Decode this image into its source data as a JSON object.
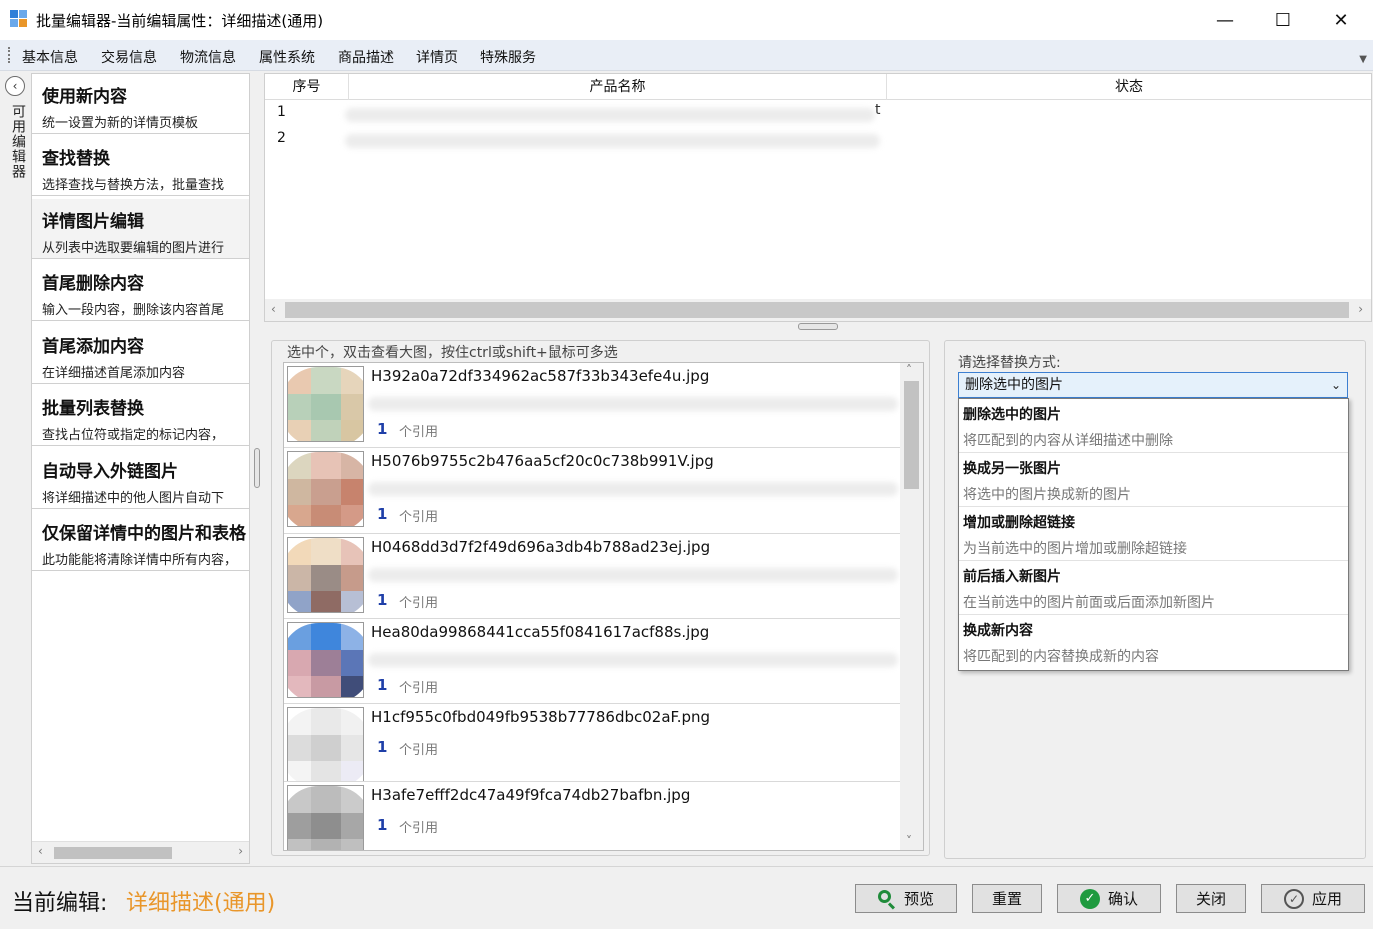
{
  "window": {
    "title": "批量编辑器-当前编辑属性：详细描述(通用)",
    "minimize": "—",
    "maximize": "☐",
    "close": "✕"
  },
  "tabs": [
    {
      "label": "基本信息"
    },
    {
      "label": "交易信息"
    },
    {
      "label": "物流信息"
    },
    {
      "label": "属性系统"
    },
    {
      "label": "商品描述"
    },
    {
      "label": "详情页"
    },
    {
      "label": "特殊服务"
    }
  ],
  "sidebar": {
    "collapse_icon": "‹",
    "label": "可用编辑器"
  },
  "features": [
    {
      "title": "使用新内容",
      "desc": "统一设置为新的详情页模板"
    },
    {
      "title": "查找替换",
      "desc": "选择查找与替换方法，批量查找"
    },
    {
      "title": "详情图片编辑",
      "desc": "从列表中选取要编辑的图片进行"
    },
    {
      "title": "首尾删除内容",
      "desc": "输入一段内容，删除该内容首尾"
    },
    {
      "title": "首尾添加内容",
      "desc": "在详细描述首尾添加内容"
    },
    {
      "title": "批量列表替换",
      "desc": "查找占位符或指定的标记内容，"
    },
    {
      "title": "自动导入外链图片",
      "desc": "将详细描述中的他人图片自动下"
    },
    {
      "title": "仅保留详情中的图片和表格",
      "desc": "此功能能将清除详情中所有内容，"
    }
  ],
  "product_table": {
    "headers": {
      "no": "序号",
      "name": "产品名称",
      "status": "状态"
    },
    "rows": [
      {
        "no": "1",
        "tail": "t"
      },
      {
        "no": "2",
        "tail": ""
      }
    ]
  },
  "image_group": {
    "label": "选中个，双击查看大图，按住ctrl或shift+鼠标可多选",
    "ref_label": "个引用",
    "items": [
      {
        "name": "H392a0a72df334962ac587f33b343efe4u.jpg",
        "refs": "1",
        "colors": [
          "#e9c9b0",
          "#c9d8c2",
          "#e6d5bb",
          "#b8d0b9",
          "#a8c8b0",
          "#d9c8a8",
          "#e8d0b5",
          "#c0d2ba",
          "#d8c6a2"
        ]
      },
      {
        "name": "H5076b9755c2b476aa5cf20c0c738b991V.jpg",
        "refs": "1",
        "colors": [
          "#dcd6bf",
          "#e7c3b6",
          "#d7b5a5",
          "#cfb7a0",
          "#c99f8f",
          "#c7836d",
          "#d8a78e",
          "#c88c76",
          "#d49a87"
        ]
      },
      {
        "name": "H0468dd3d7f2f49d696a3db4b788ad23ej.jpg",
        "refs": "1",
        "colors": [
          "#f2d9b9",
          "#efdec6",
          "#e7c3b8",
          "#cbb6a7",
          "#9a8c86",
          "#c69b8b",
          "#90a3c8",
          "#8f6b64",
          "#b7bfd5"
        ]
      },
      {
        "name": "Hea80da99868441cca55f0841617acf88s.jpg",
        "refs": "1",
        "colors": [
          "#6a9fe0",
          "#3f86dc",
          "#8db2e6",
          "#d8a8b0",
          "#9d7f97",
          "#5b76b7",
          "#e3b8bd",
          "#c89aa3",
          "#404d79"
        ]
      },
      {
        "name": "H1cf955c0fbd049fb9538b77786dbc02aF.png",
        "refs": "1",
        "colors": [
          "#f3f3f3",
          "#e9e9e9",
          "#f1f1f1",
          "#dcdcdc",
          "#cfcfcf",
          "#e6e6e6",
          "#f4f4f4",
          "#e4e4e4",
          "#ecebf5"
        ]
      },
      {
        "name": "H3afe7efff2dc47a49f9fca74db27bafbn.jpg",
        "refs": "1",
        "colors": [
          "#c8c8c8",
          "#bcbcbc",
          "#cbcbcb",
          "#9e9e9e",
          "#8e8e8e",
          "#a7a7a7",
          "#c1c1c1",
          "#b2b2b2",
          "#bfbfbf"
        ]
      }
    ]
  },
  "replace_mode": {
    "label": "请选择替换方式:",
    "selected": "删除选中的图片",
    "options": [
      {
        "title": "删除选中的图片",
        "desc": "将匹配到的内容从详细描述中删除"
      },
      {
        "title": "换成另一张图片",
        "desc": "将选中的图片换成新的图片"
      },
      {
        "title": "增加或删除超链接",
        "desc": "为当前选中的图片增加或删除超链接"
      },
      {
        "title": "前后插入新图片",
        "desc": "在当前选中的图片前面或后面添加新图片"
      },
      {
        "title": "换成新内容",
        "desc": "将匹配到的内容替换成新的内容"
      }
    ]
  },
  "status": {
    "label": "当前编辑:",
    "value": "详细描述(通用)",
    "value_color": "#e9962a"
  },
  "buttons": {
    "preview": "预览",
    "reset": "重置",
    "confirm": "确认",
    "close": "关闭",
    "apply": "应用"
  }
}
